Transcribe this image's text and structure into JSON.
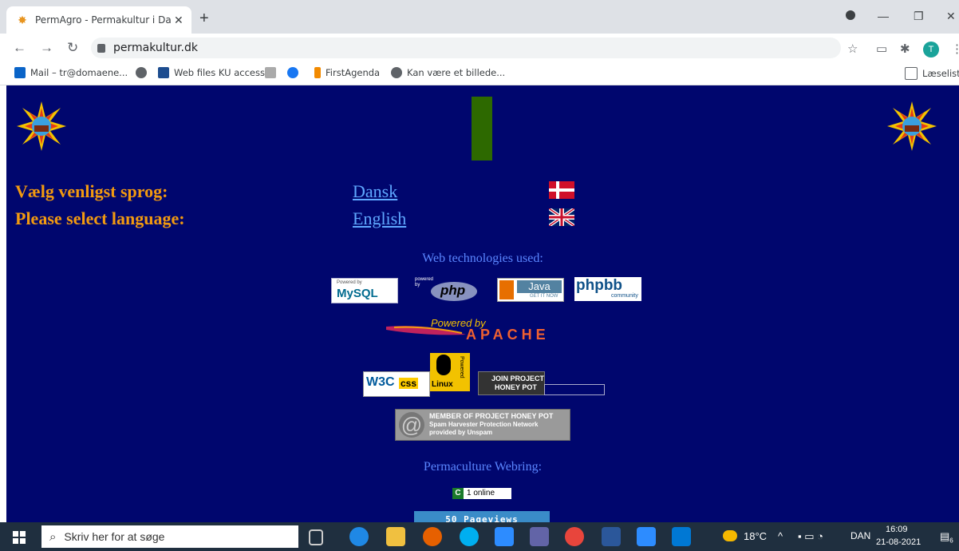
{
  "browser": {
    "tab_title": "PermAgro - Permakultur i Danmark",
    "new_tab": "+",
    "tab_close": "✕",
    "url": "permakultur.dk",
    "profile_initial": "T"
  },
  "bookmarks": [
    {
      "label": "Mail – tr@domaene...",
      "color": "#0a64c8"
    },
    {
      "label": "",
      "color": "#5f6368"
    },
    {
      "label": "Web files KU access",
      "color": "#1d4d8f"
    },
    {
      "label": "",
      "color": "#888888"
    },
    {
      "label": "",
      "color": "#1877f2"
    },
    {
      "label": "FirstAgenda",
      "color": "#f28a00"
    },
    {
      "label": "Kan være et billede...",
      "color": "#5f6368"
    }
  ],
  "reading_list": "Læseliste",
  "page": {
    "lang_prompt_da": "Vælg venligst sprog:",
    "lang_prompt_en": "Please select language:",
    "link_dansk": "Dansk",
    "link_english": "English",
    "web_tech_heading": "Web technologies used:",
    "badges": {
      "mysql_top": "Powered by",
      "mysql": "MySQL",
      "php_top": "powered by",
      "php": "php",
      "java": "Java",
      "java_sub": "GET IT NOW",
      "phpbb": "phpbb",
      "phpbb_sub": "community",
      "apache_top": "Powered by",
      "apache": "APACHE",
      "w3c": "W3C",
      "css": "css",
      "linux": "Linux",
      "linux_side": "Powered",
      "honeypot_join_1": "JOIN PROJECT",
      "honeypot_join_2": "HONEY POT",
      "honeypot_member_1": "MEMBER OF PROJECT HONEY POT",
      "honeypot_member_2": "Spam Harvester Protection Network",
      "honeypot_member_3": "provided by Unspam"
    },
    "webring_heading": "Permaculture Webring:",
    "online_letter": "C",
    "online_count": "1 online",
    "pageviews": "50 Pageviews"
  },
  "taskbar": {
    "search_placeholder": "Skriv her for at søge",
    "weather": "18°C",
    "language": "DAN",
    "time": "16:09",
    "date": "21-08-2021",
    "notifications": "6"
  }
}
